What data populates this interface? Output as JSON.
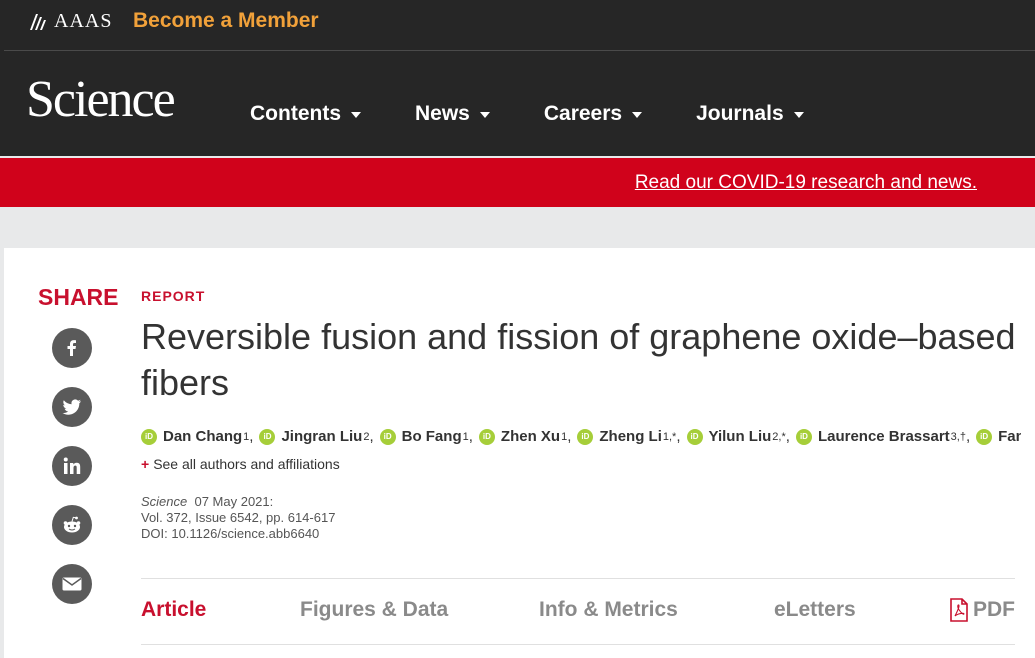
{
  "header": {
    "org_name": "AAAS",
    "member_link": "Become a Member",
    "brand": "Science",
    "nav": [
      {
        "label": "Contents"
      },
      {
        "label": "News"
      },
      {
        "label": "Careers"
      },
      {
        "label": "Journals"
      }
    ]
  },
  "banner": {
    "covid_link": "Read our COVID-19 research and news."
  },
  "share": {
    "label": "SHARE",
    "icons": [
      "facebook-icon",
      "twitter-icon",
      "linkedin-icon",
      "reddit-icon",
      "email-icon"
    ]
  },
  "article": {
    "type_label": "REPORT",
    "title": "Reversible fusion and fission of graphene oxide–based fibers",
    "authors": [
      {
        "name": "Dan Chang",
        "sup": "1"
      },
      {
        "name": "Jingran Liu",
        "sup": "2"
      },
      {
        "name": "Bo Fang",
        "sup": "1"
      },
      {
        "name": "Zhen Xu",
        "sup": "1"
      },
      {
        "name": "Zheng Li",
        "sup": "1,*"
      },
      {
        "name": "Yilun Liu",
        "sup": "2,*"
      },
      {
        "name": "Laurence Brassart",
        "sup": "3,†"
      },
      {
        "name": "Fan ...",
        "sup": ""
      }
    ],
    "see_all": "See all authors and affiliations",
    "journal": "Science",
    "date": "07 May 2021:",
    "volume": "Vol. 372, Issue 6542, pp. 614-617",
    "doi": "DOI: 10.1126/science.abb6640"
  },
  "tabs": {
    "article": "Article",
    "figures": "Figures & Data",
    "info": "Info & Metrics",
    "eletters": "eLetters",
    "pdf": "PDF"
  },
  "colors": {
    "accent_red": "#c8102e",
    "header_bg": "#262626",
    "member_orange": "#f1a13a",
    "orcid_green": "#a6ce39"
  }
}
